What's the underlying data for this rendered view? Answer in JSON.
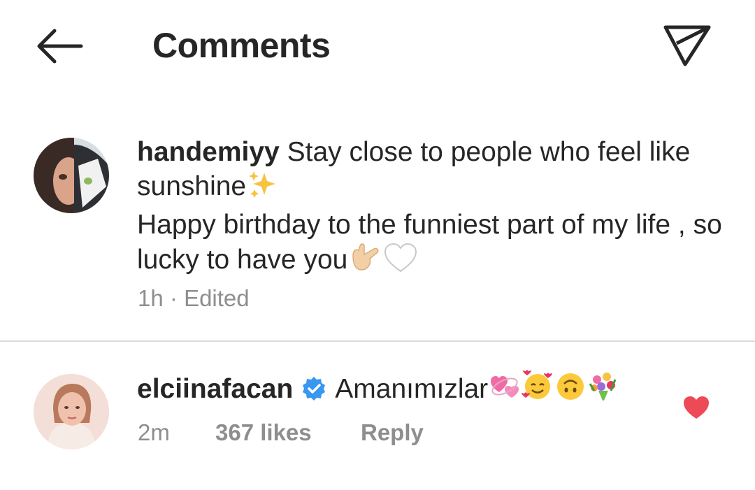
{
  "header": {
    "title": "Comments",
    "back_icon": "arrow-left-icon",
    "send_icon": "paper-plane-icon"
  },
  "comments": [
    {
      "username": "handemiyy",
      "text_line1": "Stay close to people who feel like sunshine",
      "text_line2": "Happy birthday to the funniest part of my life , so lucky to have you",
      "emojis_line1": [
        "sparkles"
      ],
      "emojis_line2": [
        "love-you-gesture",
        "white-heart"
      ],
      "time": "1h",
      "separator": "·",
      "edited": "Edited"
    },
    {
      "username": "elciinafacan",
      "verified": true,
      "text": "Amanımızlar",
      "emojis": [
        "revolving-hearts",
        "smiling-face-with-hearts",
        "upside-down-face",
        "bouquet"
      ],
      "time": "2m",
      "likes": "367 likes",
      "reply_label": "Reply",
      "liked": true,
      "like_color": "#ed4956"
    }
  ],
  "colors": {
    "text": "#262626",
    "secondary": "#8e8e8e",
    "verified": "#3897f0",
    "divider": "#dbdbdb"
  }
}
